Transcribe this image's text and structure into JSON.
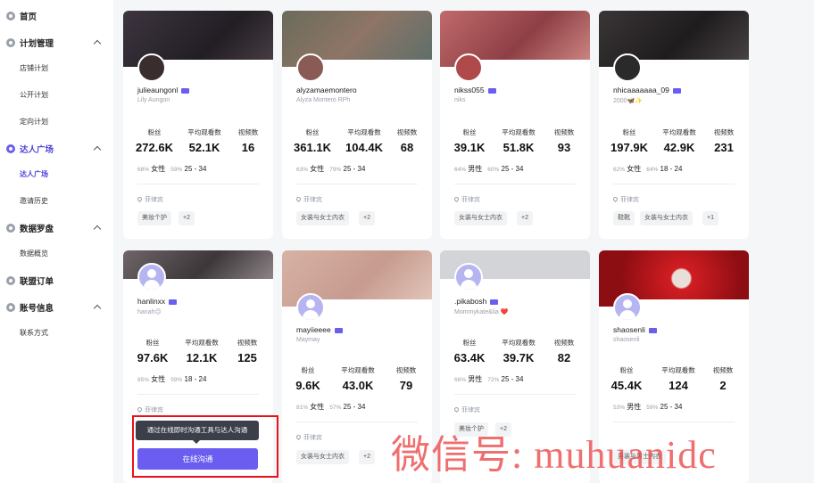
{
  "sidebar": {
    "groups": [
      {
        "label": "首页",
        "icon": "home-icon",
        "active": false
      },
      {
        "label": "计划管理",
        "icon": "plan-icon",
        "active": false,
        "items": [
          "店铺计划",
          "公开计划",
          "定向计划"
        ]
      },
      {
        "label": "达人广场",
        "icon": "creator-plaza-icon",
        "active": true,
        "items": [
          "达人广场",
          "邀请历史"
        ]
      },
      {
        "label": "数据罗盘",
        "icon": "compass-icon",
        "active": false,
        "items": [
          "数据概览"
        ]
      },
      {
        "label": "联盟订单",
        "icon": "order-icon",
        "active": false
      },
      {
        "label": "账号信息",
        "icon": "account-icon",
        "active": false,
        "items": [
          "联系方式"
        ]
      }
    ]
  },
  "stat_labels": {
    "fans": "粉丝",
    "avg_views": "平均观看数",
    "videos": "视频数"
  },
  "cards": [
    {
      "username": "julieaungonl",
      "display": "Lily Aungon",
      "fans": "272.6K",
      "avg_views": "52.1K",
      "videos": "16",
      "gender_pct": "68%",
      "gender": "女性",
      "age_pct": "59%",
      "age": "25 - 34",
      "location": "菲律宾",
      "tags": [
        "美妆个护",
        "+2"
      ],
      "avatar_color": "#3a2d2e",
      "banner_color": "#2f2a33"
    },
    {
      "username": "alyzamaemontero",
      "display": "Alyza Montero RPh",
      "fans": "361.1K",
      "avg_views": "104.4K",
      "videos": "68",
      "gender_pct": "63%",
      "gender": "女性",
      "age_pct": "79%",
      "age": "25 - 34",
      "location": "菲律宾",
      "tags": [
        "女装与女士内衣",
        "+2"
      ],
      "avatar_color": "#8a5a55",
      "banner_color": "#7d6a5c"
    },
    {
      "username": "nikss055",
      "display": "niks",
      "fans": "39.1K",
      "avg_views": "51.8K",
      "videos": "93",
      "gender_pct": "64%",
      "gender": "男性",
      "age_pct": "60%",
      "age": "25 - 34",
      "location": "菲律宾",
      "tags": [
        "女装与女士内衣",
        "+2"
      ],
      "avatar_color": "#b04a4a",
      "banner_color": "#b35a5c"
    },
    {
      "username": "nhicaaaaaaa_09",
      "display": "2000🦋✨",
      "fans": "197.9K",
      "avg_views": "42.9K",
      "videos": "231",
      "gender_pct": "62%",
      "gender": "女性",
      "age_pct": "64%",
      "age": "18 - 24",
      "location": "菲律宾",
      "tags": [
        "鞋靴",
        "女装与女士内衣",
        "+1"
      ],
      "avatar_color": "#2a2a2a",
      "banner_color": "#2e2b2c"
    },
    {
      "username": "hanlinxx",
      "display": "hanah😉",
      "fans": "97.6K",
      "avg_views": "12.1K",
      "videos": "125",
      "gender_pct": "85%",
      "gender": "女性",
      "age_pct": "59%",
      "age": "18 - 24",
      "location": "菲律宾",
      "tags": [],
      "avatar_color": "",
      "banner_color": "#5b5558"
    },
    {
      "username": "mayiieeee",
      "display": "Maymay",
      "fans": "9.6K",
      "avg_views": "43.0K",
      "videos": "79",
      "gender_pct": "81%",
      "gender": "女性",
      "age_pct": "57%",
      "age": "25 - 34",
      "location": "菲律宾",
      "tags": [
        "女装与女士内衣",
        "+2"
      ],
      "avatar_color": "",
      "banner_color": "#d8b6a8"
    },
    {
      "username": ".pikabosh",
      "display": "Mommykate&lia ❤️",
      "fans": "63.4K",
      "avg_views": "39.7K",
      "videos": "82",
      "gender_pct": "66%",
      "gender": "男性",
      "age_pct": "72%",
      "age": "25 - 34",
      "location": "菲律宾",
      "tags": [
        "美妆个护",
        "+2"
      ],
      "avatar_color": "",
      "banner_color": "#cfd0d4"
    },
    {
      "username": "shaosenli",
      "display": "shaosenli",
      "fans": "45.4K",
      "avg_views": "124",
      "videos": "2",
      "gender_pct": "53%",
      "gender": "男性",
      "age_pct": "59%",
      "age": "25 - 34",
      "location": "",
      "tags": [
        "男装与男士内衣"
      ],
      "avatar_color": "",
      "banner_color": "#b8141a"
    }
  ],
  "popup": {
    "tooltip": "通过在线即时沟通工具与达人沟通",
    "button": "在线沟通"
  },
  "watermark": "微信号: muhuanidc",
  "colors": {
    "accent": "#6b5df0",
    "highlight": "#e8101a"
  }
}
